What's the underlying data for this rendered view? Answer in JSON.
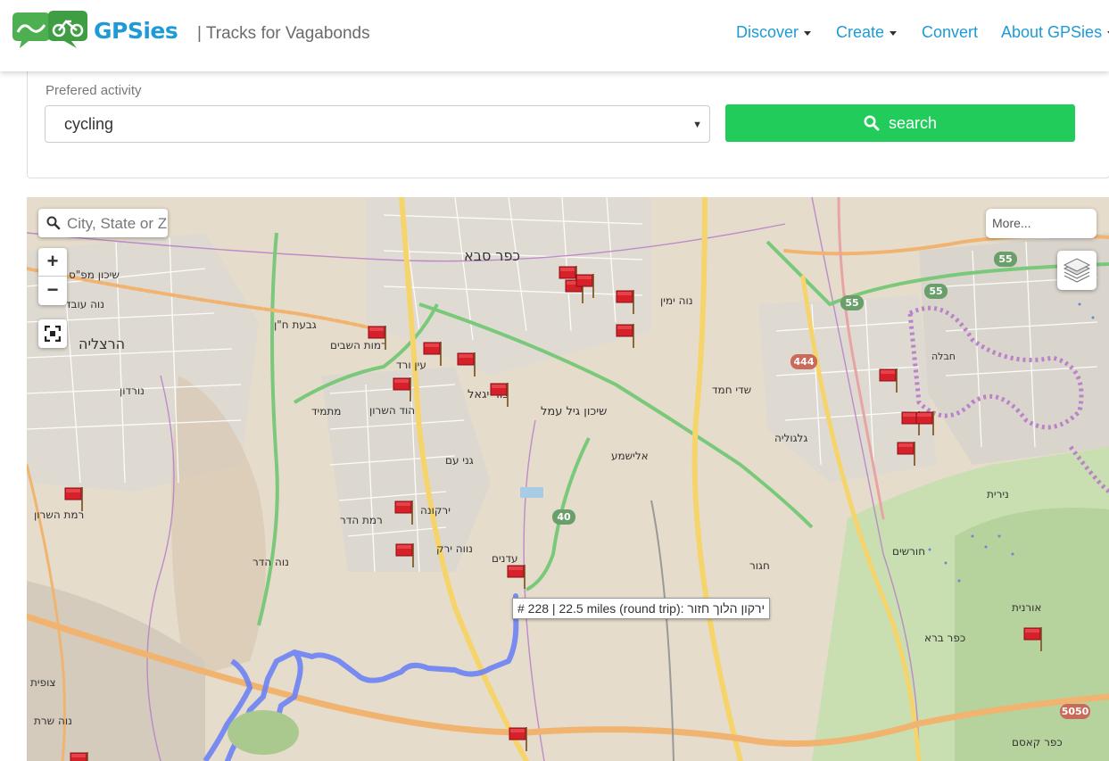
{
  "header": {
    "brand": "GPSies",
    "tagline": "| Tracks for Vagabonds",
    "nav": [
      {
        "label": "Discover",
        "dropdown": true
      },
      {
        "label": "Create",
        "dropdown": true
      },
      {
        "label": "Convert",
        "dropdown": false
      },
      {
        "label": "About GPSies",
        "dropdown": true
      }
    ]
  },
  "search_panel": {
    "activity_label": "Prefered activity",
    "activity_value": "cycling",
    "search_button": "search",
    "accent": "#22cc5b"
  },
  "map": {
    "search_placeholder": "City, State or Zip",
    "zoom_in": "+",
    "zoom_out": "−",
    "more_label": "More...",
    "tooltip": "# 228 | 22.5 miles (round trip): ירקון הלוך חזור",
    "place_labels": [
      "כפר סבא",
      "הרצליה",
      "רמות השבים",
      "גבעת ח\"ן",
      "עין ורד",
      "נוה ימין",
      "שיכון מפ\"ס",
      "נוה עובד",
      "נורדון",
      "מתמיד",
      "הוד השרון",
      "גני עם",
      "ירקונה",
      "רמת הדר",
      "צור יגאל",
      "אלישמע",
      "שדי חמד",
      "גלגוליה",
      "נווה ירק",
      "עדנים",
      "חגור",
      "חורשים",
      "כפר ברא",
      "רמת השרון",
      "נוה שרת",
      "כפר קאסם",
      "נירית",
      "אורנית",
      "חבלה",
      "צופית",
      "שיכון גיל עמל",
      "נוה הדר"
    ],
    "road_numbers": [
      "55",
      "55",
      "55",
      "444",
      "40",
      "5050"
    ],
    "colors": {
      "land": "#e6dccb",
      "route": "#6c82f5",
      "green_line": "#7ac97a",
      "yellow_road": "#f6d46c",
      "orange_road": "#f1b470",
      "boundary": "#b982c9",
      "marker": "#d6202a"
    }
  }
}
